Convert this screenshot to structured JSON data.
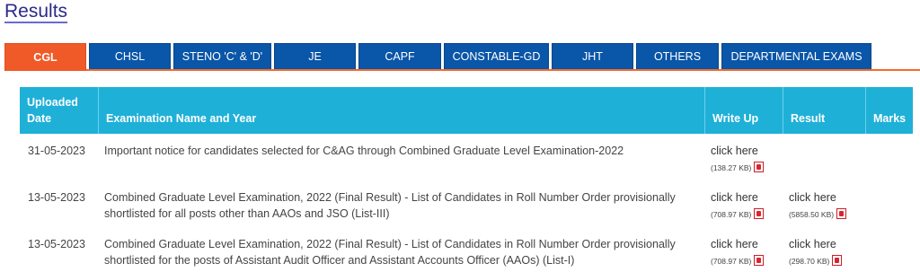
{
  "page": {
    "title": "Results"
  },
  "tabs": [
    {
      "label": "CGL",
      "active": true
    },
    {
      "label": "CHSL"
    },
    {
      "label": "STENO 'C' & 'D'"
    },
    {
      "label": "JE"
    },
    {
      "label": "CAPF"
    },
    {
      "label": "CONSTABLE-GD"
    },
    {
      "label": "JHT"
    },
    {
      "label": "OTHERS"
    },
    {
      "label": "DEPARTMENTAL EXAMS"
    }
  ],
  "colors": {
    "tab_bg": "#0a56a8",
    "tab_active": "#f05a28",
    "header_bg": "#1fb0d8",
    "accent_line": "#f26b2a"
  },
  "table": {
    "headers": {
      "uploaded_date_line1": "Uploaded",
      "uploaded_date_line2": "Date",
      "exam_name": "Examination Name and Year",
      "write_up": "Write Up",
      "result": "Result",
      "marks": "Marks"
    },
    "rows": [
      {
        "date": "31-05-2023",
        "exam_line1": "Important notice for candidates selected for C&AG through Combined Graduate Level Examination-2022",
        "exam_line2": "",
        "write_up_link": "click here",
        "write_up_size": "(138.27 KB)",
        "result_link": "",
        "result_size": ""
      },
      {
        "date": "13-05-2023",
        "exam_line1": "Combined Graduate Level Examination, 2022 (Final Result) - List of Candidates in Roll Number Order provisionally",
        "exam_line2": "shortlisted for all posts other than AAOs and JSO (List-III)",
        "write_up_link": "click here",
        "write_up_size": "(708.97 KB)",
        "result_link": "click here",
        "result_size": "(5858.50 KB)"
      },
      {
        "date": "13-05-2023",
        "exam_line1": "Combined Graduate Level Examination, 2022 (Final Result) - List of Candidates in Roll Number Order provisionally",
        "exam_line2": "shortlisted for the posts of Assistant Audit Officer and Assistant Accounts Officer (AAOs) (List-I)",
        "write_up_link": "click here",
        "write_up_size": "(708.97 KB)",
        "result_link": "click here",
        "result_size": "(298.70 KB)"
      }
    ]
  }
}
